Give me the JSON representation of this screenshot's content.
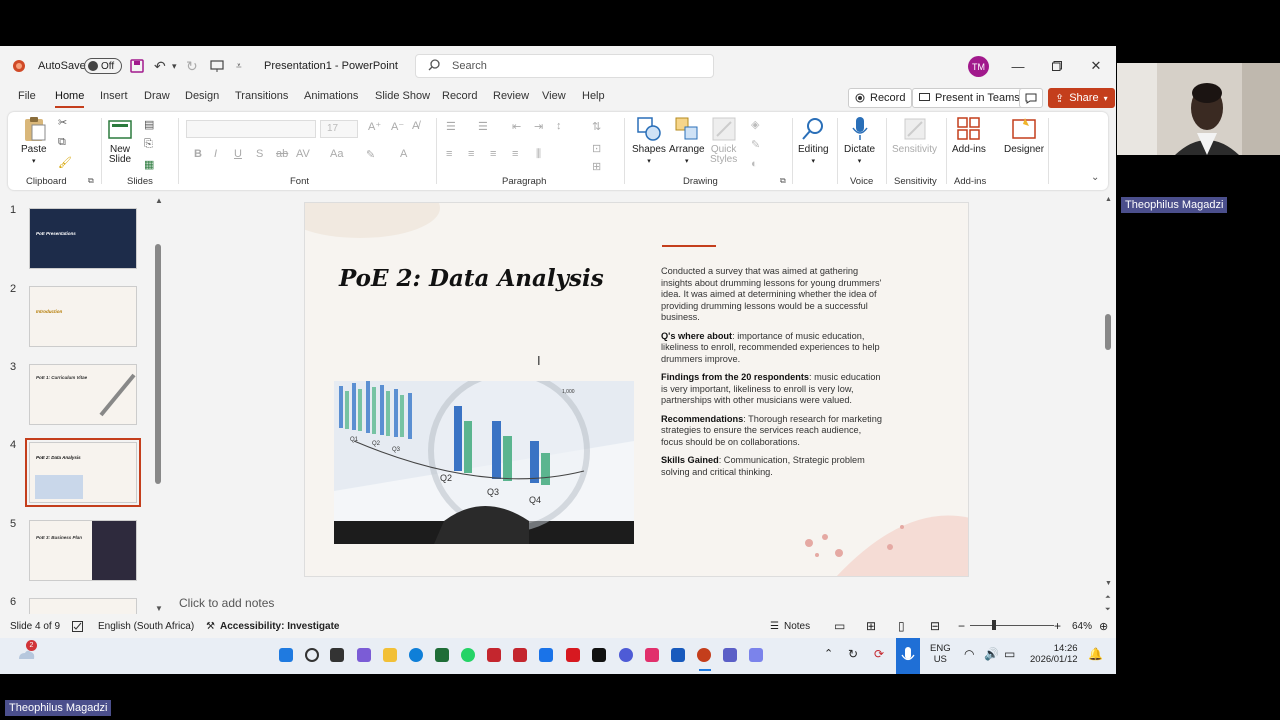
{
  "titlebar": {
    "autosave_label": "AutoSave",
    "autosave_state": "Off",
    "document_title": "Presentation1 - PowerPoint",
    "search_placeholder": "Search",
    "user_initials": "TM"
  },
  "menu": {
    "tabs": [
      "File",
      "Home",
      "Insert",
      "Draw",
      "Design",
      "Transitions",
      "Animations",
      "Slide Show",
      "Record",
      "Review",
      "View",
      "Help"
    ],
    "active_tab": "Home",
    "record_button": "Record",
    "present_teams_button": "Present in Teams",
    "share_button": "Share"
  },
  "ribbon": {
    "paste": "Paste",
    "new_slide": [
      "New",
      "Slide"
    ],
    "font_size": "17",
    "shapes": "Shapes",
    "arrange": "Arrange",
    "quick_styles": [
      "Quick",
      "Styles"
    ],
    "editing": "Editing",
    "dictate": "Dictate",
    "sensitivity_btn": "Sensitivity",
    "addins_btn": "Add-ins",
    "designer": "Designer",
    "groups": {
      "clipboard": "Clipboard",
      "slides": "Slides",
      "font": "Font",
      "paragraph": "Paragraph",
      "drawing": "Drawing",
      "voice": "Voice",
      "sensitivity": "Sensitivity",
      "addins": "Add-ins"
    }
  },
  "thumbnails": [
    {
      "num": "1",
      "title": "PoE Presentations"
    },
    {
      "num": "2",
      "title": "Introduction"
    },
    {
      "num": "3",
      "title": "PoE 1: Curriculum Vitae"
    },
    {
      "num": "4",
      "title": "PoE 2: Data Analysis"
    },
    {
      "num": "5",
      "title": "PoE 3: Business Plan"
    },
    {
      "num": "6",
      "title": ""
    }
  ],
  "slide": {
    "title": "PoE 2: Data Analysis",
    "intro": "Conducted a survey that was aimed at gathering insights about drumming lessons for young drummers' idea. It was aimed at determining whether the idea of providing drumming lessons would be a successful business.",
    "q_label": "Q's where about",
    "q_text": ": importance of music education, likeliness to enroll, recommended experiences to help drummers improve.",
    "findings_label": "Findings from the 20 respondents",
    "findings_text": ": music education  is very important, likeliness to enroll is very low, partnerships with other musicians were valued.",
    "rec_label": "Recommendations",
    "rec_text": ": Thorough research for marketing strategies to ensure the services reach audience, focus should be on collaborations.",
    "skills_label": "Skills Gained",
    "skills_text": ": Communication, Strategic problem solving and critical thinking.",
    "image_labels": [
      "Q1",
      "Q2",
      "Q3",
      "Q2",
      "Q3",
      "Q4",
      "1,000"
    ]
  },
  "notes_placeholder": "Click to add notes",
  "status": {
    "slide_info": "Slide 4 of 9",
    "language": "English (South Africa)",
    "accessibility": "Accessibility: Investigate",
    "notes": "Notes",
    "zoom": "64%"
  },
  "taskbar": {
    "weather_badge": "2",
    "lang": "ENG",
    "region": "US",
    "time": "14:26",
    "date": "2026/01/12"
  },
  "webcam": {
    "participant_name": "Theophilus Magadzi",
    "bottom_name": "Theophilus Magadzi"
  }
}
